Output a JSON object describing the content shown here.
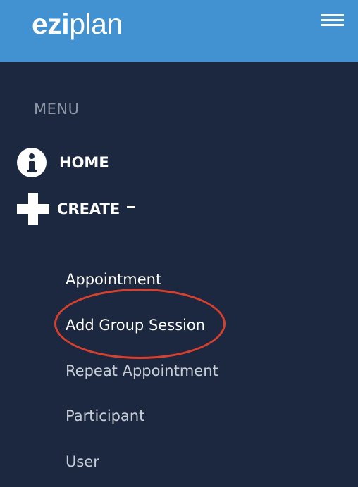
{
  "header": {
    "logo_bold": "ezi",
    "logo_regular": "plan",
    "menu_icon": "hamburger-icon",
    "background_color": "#4292d2"
  },
  "sidebar": {
    "heading": "MENU",
    "background_color": "#1c2740",
    "items": [
      {
        "label": "HOME",
        "icon": "info-icon"
      },
      {
        "label": "CREATE",
        "icon": "plus-icon",
        "expanded": true,
        "toggle_icon": "minus-icon"
      }
    ],
    "create_submenu": [
      {
        "label": "Appointment"
      },
      {
        "label": "Add Group Session",
        "highlighted": true
      },
      {
        "label": "Repeat Appointment"
      },
      {
        "label": "Participant"
      },
      {
        "label": "User"
      }
    ]
  },
  "annotation": {
    "color": "#d8402e"
  }
}
